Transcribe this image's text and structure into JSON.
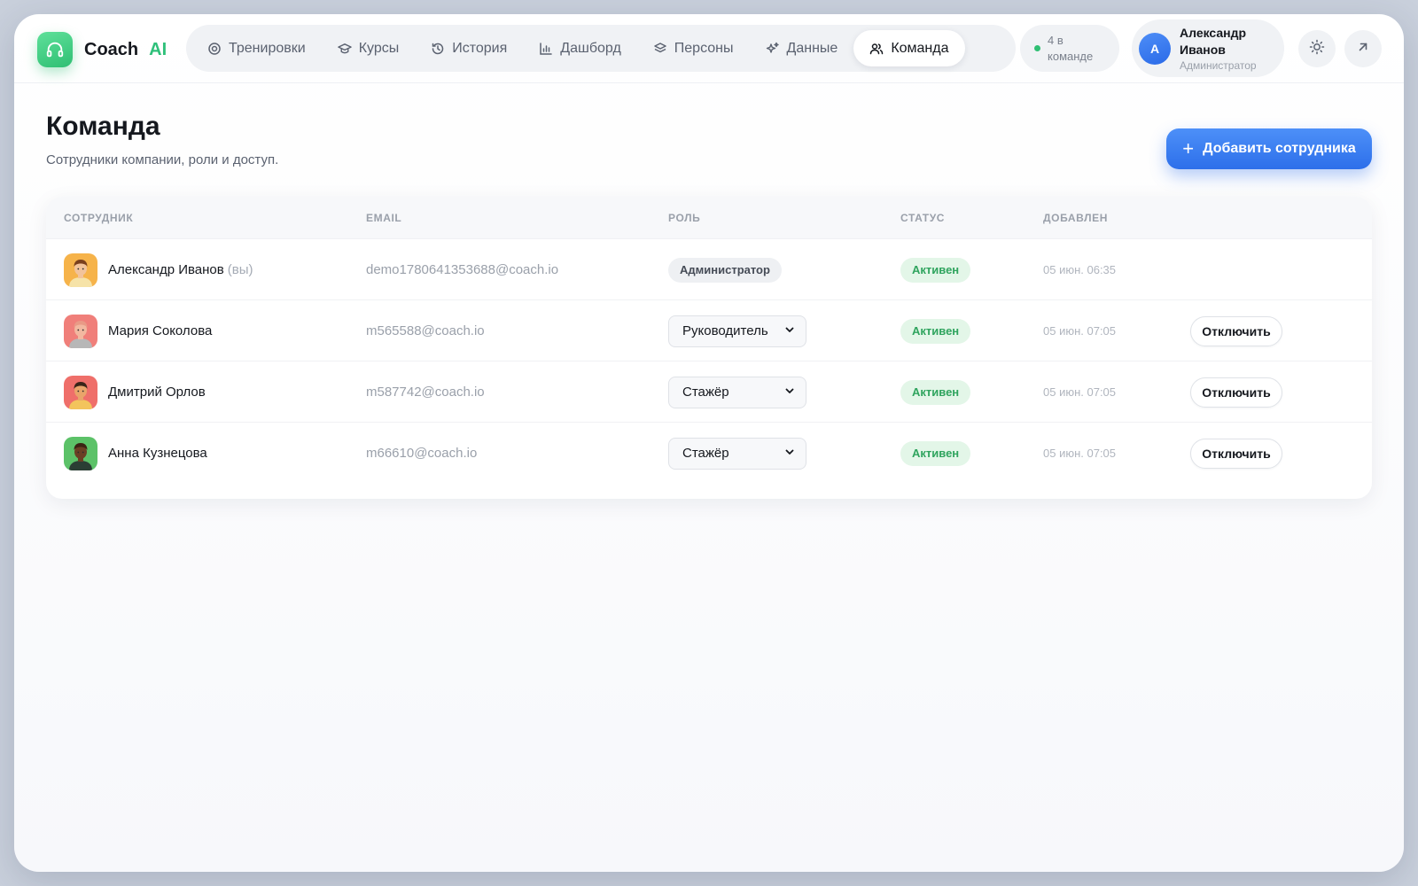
{
  "app": {
    "name": "Coach",
    "name_accent": "AI"
  },
  "nav": {
    "items": [
      {
        "label": "Тренировки",
        "icon": "target-icon"
      },
      {
        "label": "Курсы",
        "icon": "graduation-cap-icon"
      },
      {
        "label": "История",
        "icon": "history-icon"
      },
      {
        "label": "Дашборд",
        "icon": "bar-chart-icon"
      },
      {
        "label": "Персоны",
        "icon": "layers-icon"
      },
      {
        "label": "Данные",
        "icon": "sparkles-icon"
      },
      {
        "label": "Команда",
        "icon": "users-icon",
        "active": true
      }
    ]
  },
  "team_count": {
    "text": "4 в команде",
    "status_color": "#2fbf73"
  },
  "user": {
    "initial": "А",
    "name": "Александр Иванов",
    "role": "Администратор"
  },
  "actions": {
    "theme_icon": "sun-icon",
    "exit_icon": "arrow-up-right-icon"
  },
  "page": {
    "title": "Команда",
    "subtitle": "Сотрудники компании, роли и доступ.",
    "add_button": "Добавить сотрудника"
  },
  "table": {
    "headers": {
      "employee": "СОТРУДНИК",
      "email": "EMAIL",
      "role": "РОЛЬ",
      "status": "СТАТУС",
      "added": "ДОБАВЛЕН"
    },
    "rows": [
      {
        "name": "Александр Иванов",
        "you": "(вы)",
        "email": "demo1780641353688@coach.io",
        "role": "Администратор",
        "status": "Активен",
        "added": "05 июн. 06:35",
        "avatar_bg": "#f6b34a",
        "avatar_skin": "#f2c39b",
        "avatar_hair": "#7a3f1c",
        "avatar_shirt": "#f6e3a8"
      },
      {
        "name": "Мария Соколова",
        "email": "m565588@coach.io",
        "role": "Руководитель",
        "status": "Активен",
        "added": "05 июн. 07:05",
        "action": "Отключить",
        "avatar_bg": "#f07f7a",
        "avatar_skin": "#f2b8a0",
        "avatar_hair": "#e99a86",
        "avatar_shirt": "#b7b7b7"
      },
      {
        "name": "Дмитрий Орлов",
        "email": "m587742@coach.io",
        "role": "Стажёр",
        "status": "Активен",
        "added": "05 июн. 07:05",
        "action": "Отключить",
        "avatar_bg": "#ef6f6a",
        "avatar_skin": "#e9a46a",
        "avatar_hair": "#3a2418",
        "avatar_shirt": "#f3c45c"
      },
      {
        "name": "Анна Кузнецова",
        "email": "m66610@coach.io",
        "role": "Стажёр",
        "status": "Активен",
        "added": "05 июн. 07:05",
        "action": "Отключить",
        "avatar_bg": "#5cc268",
        "avatar_skin": "#6b3f24",
        "avatar_hair": "#3b2213",
        "avatar_shirt": "#2b3e34"
      }
    ]
  }
}
